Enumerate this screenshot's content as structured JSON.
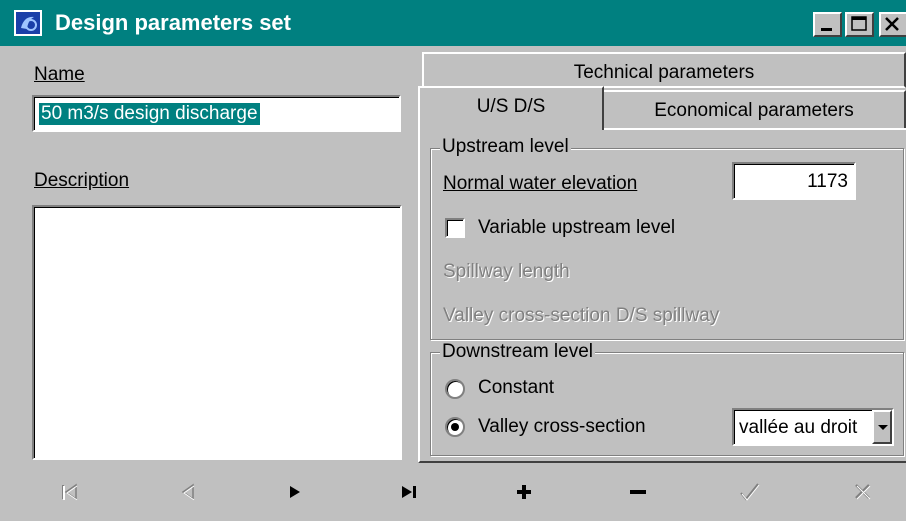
{
  "window": {
    "title": "Design parameters set",
    "controls": {
      "minimize": "minimize",
      "maximize": "maximize",
      "close": "close"
    }
  },
  "form": {
    "name_label": "Name",
    "name_value": "50 m3/s design discharge",
    "description_label": "Description",
    "description_value": ""
  },
  "tabs": {
    "row1": [
      "Technical parameters"
    ],
    "row2": [
      "U/S D/S",
      "Economical parameters"
    ],
    "active": "U/S D/S"
  },
  "upstream": {
    "group_title": "Upstream level",
    "normal_water_elevation_label": "Normal water elevation",
    "normal_water_elevation_value": "1173",
    "variable_upstream_label": "Variable upstream level",
    "variable_upstream_checked": false,
    "spillway_length_label": "Spillway length",
    "valley_cross_section_label": "Valley cross-section D/S spillway"
  },
  "downstream": {
    "group_title": "Downstream level",
    "constant_label": "Constant",
    "valley_label": "Valley cross-section",
    "selected": "Valley cross-section",
    "valley_select_value": "vallée au droit"
  },
  "navigator": {
    "buttons": [
      "first-icon",
      "prior-icon",
      "next-icon",
      "last-icon",
      "insert-icon",
      "delete-icon",
      "post-icon",
      "cancel-icon"
    ]
  },
  "colors": {
    "title_bar": "#008080",
    "selection": "#008080",
    "face": "#c0c0c0"
  }
}
